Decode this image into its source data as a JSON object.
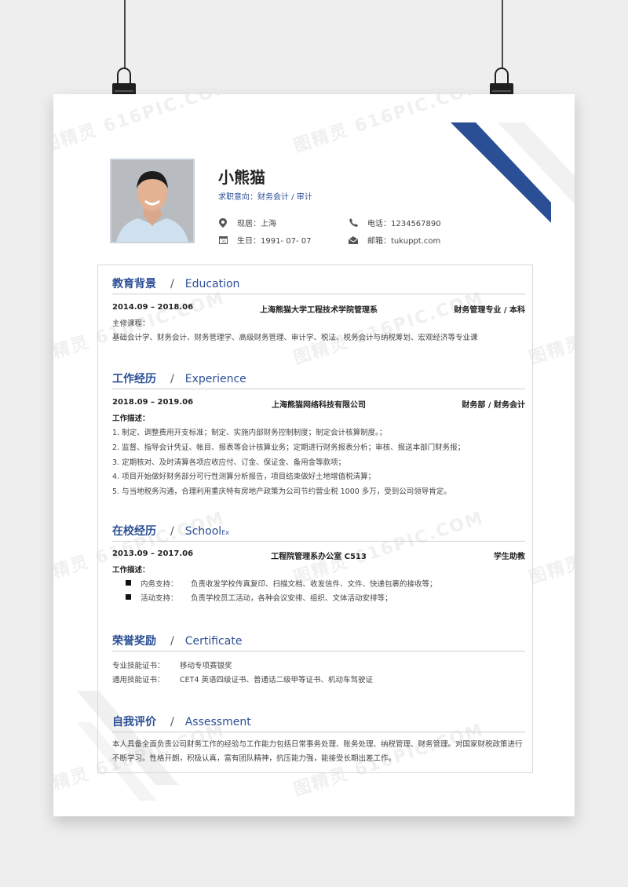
{
  "profile": {
    "name": "小熊猫",
    "intent": "求职意向：财务会计 / 审计",
    "location": "现居：上海",
    "phone": "电话：1234567890",
    "birthday": "生日：1991- 07- 07",
    "email": "邮箱：tukuppt.com"
  },
  "watermark": "图精灵 616PIC.COM",
  "education": {
    "title_zh": "教育背景",
    "title_en": "Education",
    "period": "2014.09 – 2018.06",
    "school": "上海熊猫大学工程技术学院管理系",
    "degree": "财务管理专业 / 本科",
    "courses_label": "主修课程：",
    "courses": "基础会计学、财务会计、财务管理学、高级财务管理、审计学、税法、税务会计与纳税筹划、宏观经济等专业课"
  },
  "experience": {
    "title_zh": "工作经历",
    "title_en": "Experience",
    "period": "2018.09 – 2019.06",
    "company": "上海熊猫网络科技有限公司",
    "role": "财务部 / 财务会计",
    "desc_label": "工作描述：",
    "items": [
      "1. 制定、调整费用开支标准；制定、实施内部财务控制制度；制定会计核算制度。；",
      "2. 监督、指导会计凭证、帐目、报表等会计核算业务；定期进行财务报表分析；审核、报送本部门财务报；",
      "3. 定期核对、及时清算各项应收应付、订金、保证金、备用金等款项；",
      "4. 项目开始做好财务部分可行性测算分析报告，项目结束做好土地增值税清算；",
      "5. 与当地税务沟通，合理利用重庆特有房地产政策为公司节约营业税 1000 多万，受到公司领导肯定。"
    ]
  },
  "school": {
    "title_zh": "在校经历",
    "title_en": "School",
    "title_en_tail": "Ex",
    "period": "2013.09 – 2017.06",
    "org": "工程院管理系办公室 C513",
    "role": "学生助教",
    "desc_label": "工作描述：",
    "bullets": [
      {
        "key": "内务支持：",
        "value": "负责收发学校传真复印、扫描文档、收发信件、文件、快递包裹的接收等；"
      },
      {
        "key": "活动支持：",
        "value": "负责学校员工活动，各种会议安排、组织、文体活动安排等；"
      }
    ]
  },
  "certificate": {
    "title_zh": "荣誉奖励",
    "title_en": "Certificate",
    "rows": [
      {
        "key": "专业技能证书：",
        "value": "移动专项赛银奖"
      },
      {
        "key": "通用技能证书：",
        "value": "CET4  英语四级证书、普通话二级甲等证书、机动车驾驶证"
      }
    ]
  },
  "assessment": {
    "title_zh": "自我评价",
    "title_en": "Assessment",
    "text": "本人具备全面负责公司财务工作的经验与工作能力包括日常事务处理、账务处理、纳税管理、财务管理。对国家财税政策进行不断学习。性格开朗，积极认真，富有团队精神，抗压能力强，能接受长期出差工作。"
  },
  "colors": {
    "accent": "#2b4f95",
    "text": "#333333",
    "line": "#cfcfcf"
  },
  "icons": [
    "location-icon",
    "phone-icon",
    "calendar-icon",
    "email-icon"
  ]
}
